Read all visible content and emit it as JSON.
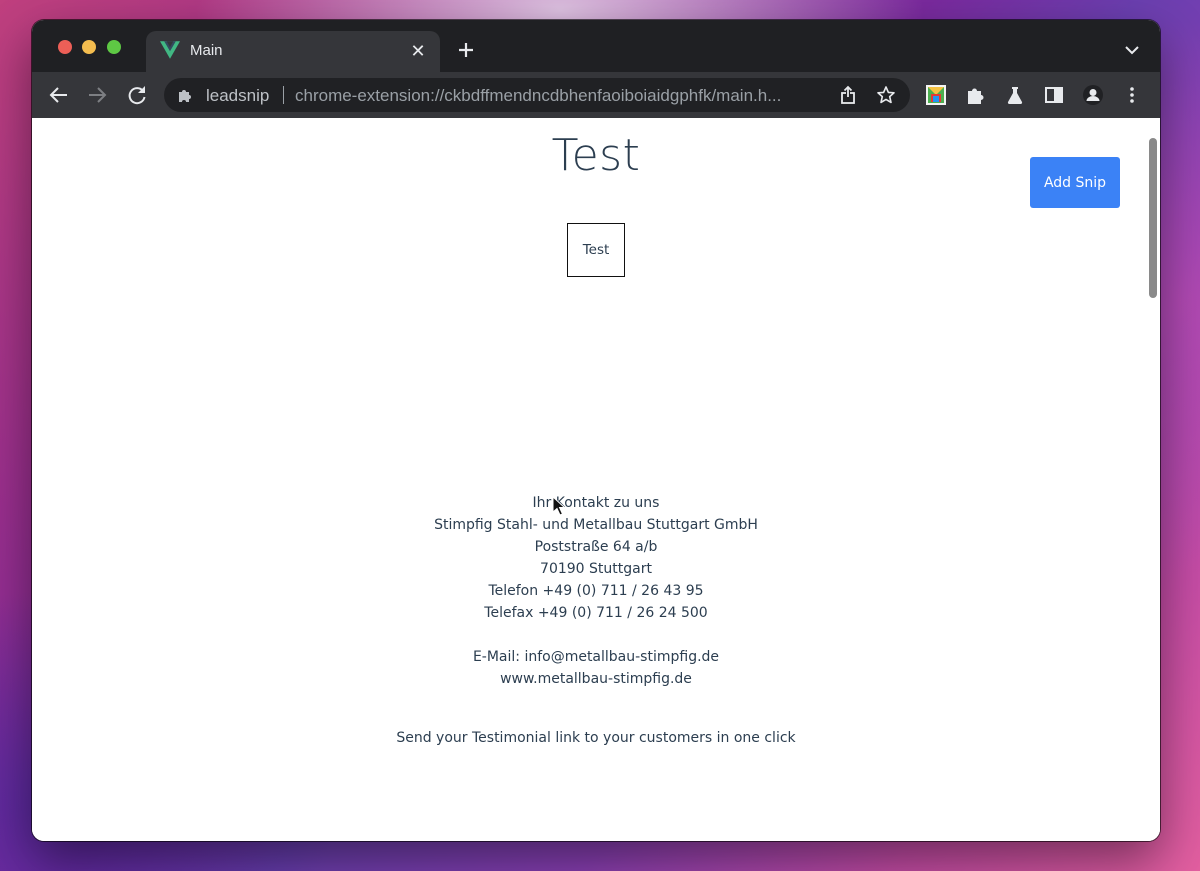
{
  "browser": {
    "tab": {
      "title": "Main",
      "favicon": "vue-logo-icon",
      "close_glyph": "✕"
    },
    "new_tab_glyph": "+",
    "toolbar": {
      "back": "arrow-left-icon",
      "forward": "arrow-right-icon",
      "reload": "reload-icon"
    },
    "omnibox": {
      "site_label": "leadsnip",
      "url": "chrome-extension://ckbdffmendncdbhenfaoiboiaidgphfk/main.h..."
    },
    "extensions": [
      "leadsnip-extension-icon",
      "puzzle-icon",
      "labs-flask-icon",
      "side-panel-icon",
      "profile-icon",
      "kebab-menu-icon"
    ]
  },
  "page": {
    "title": "Test",
    "add_snip_label": "Add Snip",
    "snip_card_label": "Test",
    "contact": {
      "lines": [
        "Ihr Kontakt zu uns",
        "Stimpfig Stahl- und Metallbau Stuttgart GmbH",
        "Poststraße 64 a/b",
        "70190 Stuttgart",
        "Telefon +49 (0) 711 / 26 43 95",
        "Telefax +49 (0) 711 / 26 24 500"
      ],
      "email": "E-Mail: info@metallbau-stimpfig.de",
      "website": "www.metallbau-stimpfig.de"
    },
    "footer_note": "Send your Testimonial link to your customers in one click"
  },
  "colors": {
    "accent": "#3b82f6",
    "text": "#2c3e50",
    "chrome_dark": "#35363a"
  }
}
